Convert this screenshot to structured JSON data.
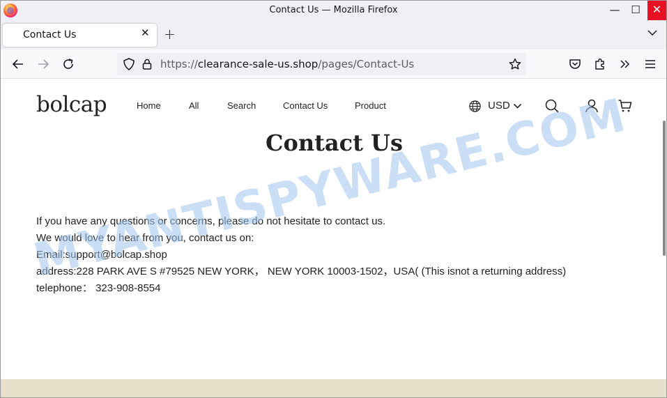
{
  "window": {
    "title": "Contact Us — Mozilla Firefox",
    "minimize": "—",
    "maximize": "☐",
    "close": "✕"
  },
  "tab": {
    "label": "Contact Us",
    "close": "✕",
    "new_tab": "+"
  },
  "navbar": {
    "url_scheme": "https://",
    "url_host": "clearance-sale-us.shop",
    "url_path": "/pages/Contact-Us"
  },
  "site": {
    "logo": "bolcap",
    "nav": [
      "Home",
      "All",
      "Search",
      "Contact Us",
      "Product"
    ],
    "currency": "USD"
  },
  "content": {
    "title": "Contact Us",
    "lines": [
      "If you have any questions or concerns, please do not hesitate to contact us.",
      "We would love to hear from you, contact us on:",
      "Email:support@bolcap.shop",
      "address:228 PARK AVE S #79525 NEW YORK， NEW YORK 10003-1502，USA( (This isnot a returning address)",
      "telephone： 323-908-8554"
    ]
  },
  "watermark": "MYANTISPYWARE.COM",
  "colors": {
    "close_red": "#e81123",
    "footer_beige": "#e6dfc9",
    "watermark_blue": "#9ec3ee"
  }
}
